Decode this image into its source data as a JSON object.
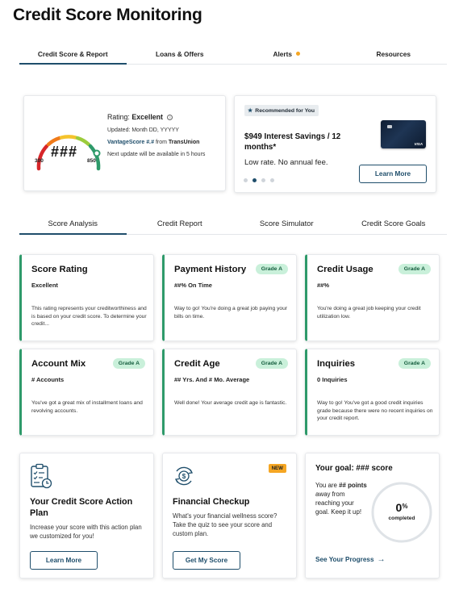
{
  "page": {
    "title": "Credit Score Monitoring"
  },
  "top_tabs": [
    {
      "label": "Credit Score & Report",
      "active": true
    },
    {
      "label": "Loans & Offers",
      "active": false
    },
    {
      "label": "Alerts",
      "active": false,
      "notification_dot": true
    },
    {
      "label": "Resources",
      "active": false
    }
  ],
  "score": {
    "value": "###",
    "min": "300",
    "max": "850",
    "rating_label": "Rating:",
    "rating_value": "Excellent",
    "updated": "Updated: Month DD, YYYYY",
    "vantage_name": "VantageScore",
    "vantage_version": "#.#",
    "vantage_from": "from",
    "bureau": "TransUnion",
    "next_update": "Next update will be available in 5 hours"
  },
  "recommended": {
    "badge": "Recommended for You",
    "title": "$949 Interest Savings / 12 months*",
    "subtitle": "Low rate. No annual fee.",
    "button": "Learn More",
    "card_brand": "VISA",
    "carousel_total": 4,
    "carousel_active": 2
  },
  "analysis_tabs": [
    {
      "label": "Score Analysis",
      "active": true
    },
    {
      "label": "Credit Report",
      "active": false
    },
    {
      "label": "Score Simulator",
      "active": false
    },
    {
      "label": "Credit Score Goals",
      "active": false
    }
  ],
  "factors": [
    {
      "title": "Score Rating",
      "grade": "",
      "value": "Excellent",
      "desc": "This rating represents your creditworthiness and is based on your credit score. To determine your credit..."
    },
    {
      "title": "Payment History",
      "grade": "Grade A",
      "value": "##% On Time",
      "desc": "Way to go! You're doing a great job paying your bills on time."
    },
    {
      "title": "Credit Usage",
      "grade": "Grade A",
      "value": "##%",
      "desc": "You're doing a great job keeping your credit utilization low."
    },
    {
      "title": "Account Mix",
      "grade": "Grade A",
      "value": "# Accounts",
      "desc": "You've got a great mix of installment loans and revolving accounts."
    },
    {
      "title": "Credit Age",
      "grade": "Grade A",
      "value": "## Yrs. And # Mo. Average",
      "desc": "Well done! Your average credit age is fantastic."
    },
    {
      "title": "Inquiries",
      "grade": "Grade A",
      "value": "0 Inquiries",
      "desc": "Way to go! You've got a good credit inquiries grade because there were no recent inquiries on your credit report."
    }
  ],
  "action_plan": {
    "title": "Your Credit Score Action Plan",
    "desc": "Increase your score with this action plan we customized for you!",
    "button": "Learn More"
  },
  "checkup": {
    "badge": "NEW",
    "title": "Financial Checkup",
    "desc": "What's your financial wellness score? Take the quiz to see your score and custom plan.",
    "button": "Get My Score"
  },
  "goal": {
    "title": "Your goal: ### score",
    "text_pre": "You are",
    "points": "## points",
    "text_post": "away from reaching your goal. Keep it up!",
    "progress_value": "0",
    "progress_unit": "%",
    "progress_label": "completed",
    "progress_fraction": 0,
    "link": "See Your Progress"
  },
  "colors": {
    "accent": "#1f4e6b",
    "grade_bg": "#c9f0da",
    "grade_text": "#155d3e",
    "factor_border": "#2e9a6a",
    "alert_dot": "#f5a623"
  }
}
